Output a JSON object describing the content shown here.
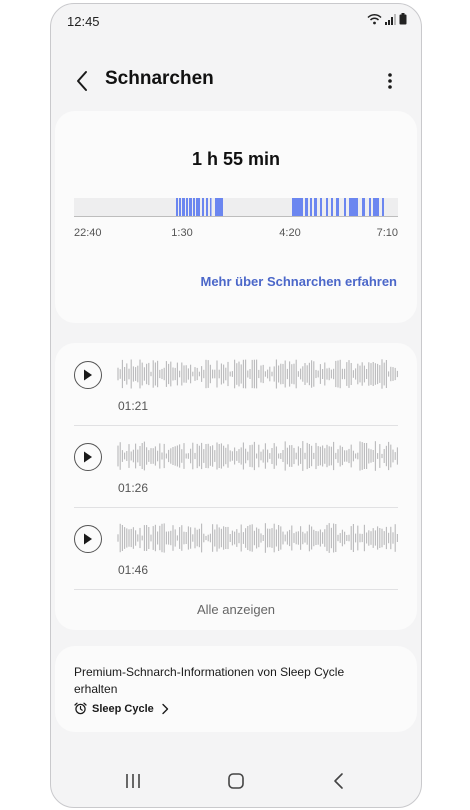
{
  "status_bar": {
    "time": "12:45"
  },
  "header": {
    "title": "Schnarchen"
  },
  "summary": {
    "duration": "1 h 55 min",
    "timeline_ticks": [
      "22:40",
      "1:30",
      "4:20",
      "7:10"
    ],
    "learn_more_link": "Mehr über Schnarchen erfahren",
    "accent_color": "#6b86f0"
  },
  "recordings": {
    "items": [
      {
        "duration": "01:21"
      },
      {
        "duration": "01:26"
      },
      {
        "duration": "01:46"
      }
    ],
    "show_all_label": "Alle anzeigen"
  },
  "premium": {
    "text": "Premium-Schnarch-Informationen von Sleep Cycle erhalten",
    "brand_label": "Sleep Cycle",
    "brand_icon": "alarm-clock-icon"
  },
  "nav": {
    "items": [
      "recent-apps-icon",
      "home-icon",
      "back-icon"
    ]
  }
}
